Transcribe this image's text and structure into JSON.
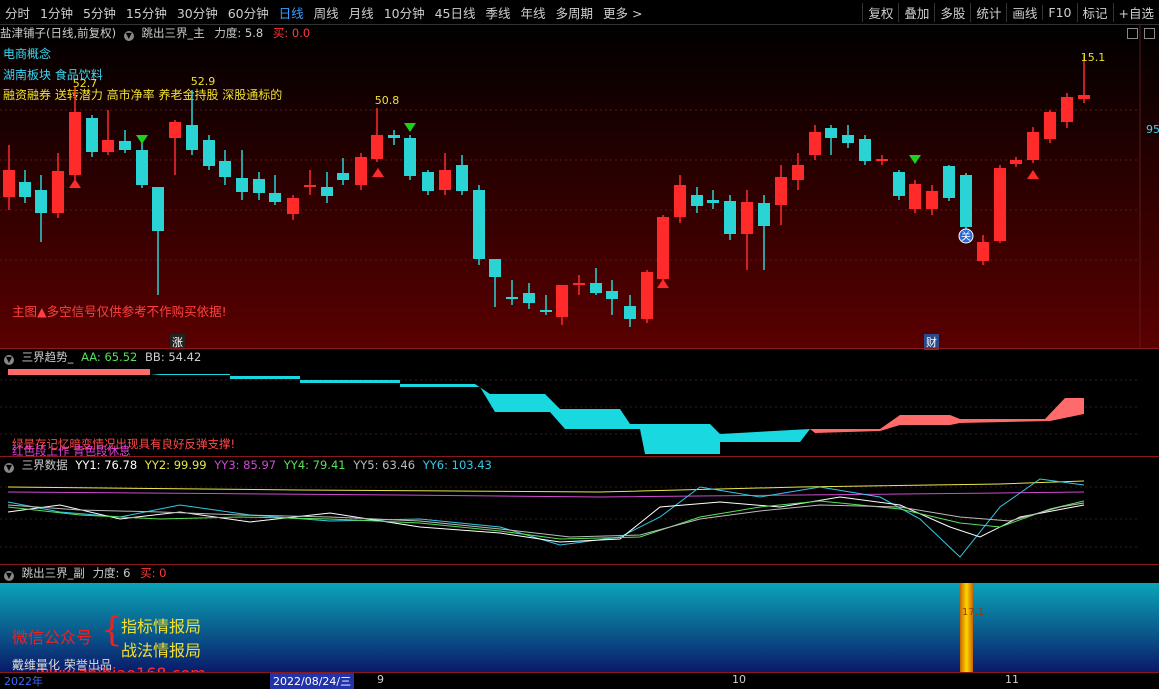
{
  "menu": {
    "periods": [
      "分时",
      "1分钟",
      "5分钟",
      "15分钟",
      "30分钟",
      "60分钟",
      "日线",
      "周线",
      "月线",
      "10分钟",
      "45日线",
      "季线",
      "年线",
      "多周期",
      "更多 >"
    ],
    "active": "日线",
    "right_tools": [
      "复权",
      "叠加",
      "多股",
      "统计",
      "画线",
      "F10",
      "标记",
      "+自选"
    ]
  },
  "main": {
    "stock": "盐津铺子(日线,前复权)",
    "indicator_name": "跳出三界_主",
    "strength_label": "力度:",
    "strength_value": "5.8",
    "buy_label": "买:",
    "buy_value": "0.0",
    "concepts": [
      "电商概念",
      "湖南板块  食品饮料"
    ],
    "tags": "融资融券 送转潜力 高市净率 养老金持股 深股通标的",
    "disclaimer": "主图▲多空信号仅供参考不作购买依据!",
    "price_labels": [
      "52.7",
      "52.9",
      "50.8",
      "15.1"
    ],
    "right_axis_value": "95",
    "markers": [
      "涨",
      "财",
      "关"
    ]
  },
  "trend": {
    "name": "三界趋势_",
    "aa_label": "AA:",
    "aa_value": "65.52",
    "bb_label": "BB:",
    "bb_value": "54.42",
    "note1": "绿是存记忆暗变情况出现具有良好反弹支撑!",
    "note2": "红色段上作 青色段休息"
  },
  "sdata": {
    "name": "三界数据",
    "yy1": "YY1: 76.78",
    "yy2": "YY2: 99.99",
    "yy3": "YY3: 85.97",
    "yy4": "YY4: 79.41",
    "yy5": "YY5: 63.46",
    "yy6": "YY6: 103.43"
  },
  "sub": {
    "name": "跳出三界_副",
    "strength_label": "力度:",
    "strength_value": "6",
    "buy_label": "买:",
    "buy_value": "0",
    "wechat": "微信公众号",
    "brace": "{",
    "line1": "指标情报局",
    "line2": "战法情报局",
    "credit": "戴维量化 荣誉出品",
    "website": "www.zhibiao168.com",
    "bar_label": "17.1"
  },
  "xaxis": {
    "labels": [
      "2022年",
      "2022/08/24/三",
      "9",
      "10",
      "11"
    ]
  },
  "colors": {
    "up": "#ff2b2b",
    "down": "#2ad4d4",
    "trend_red": "#ff6a6a",
    "trend_cyan": "#19d8e0",
    "yy1": "#ffffff",
    "yy2": "#e8e84a",
    "yy3": "#d04ad0",
    "yy4": "#58e058",
    "yy5": "#bbbbbb",
    "yy6": "#35c9e6"
  }
}
